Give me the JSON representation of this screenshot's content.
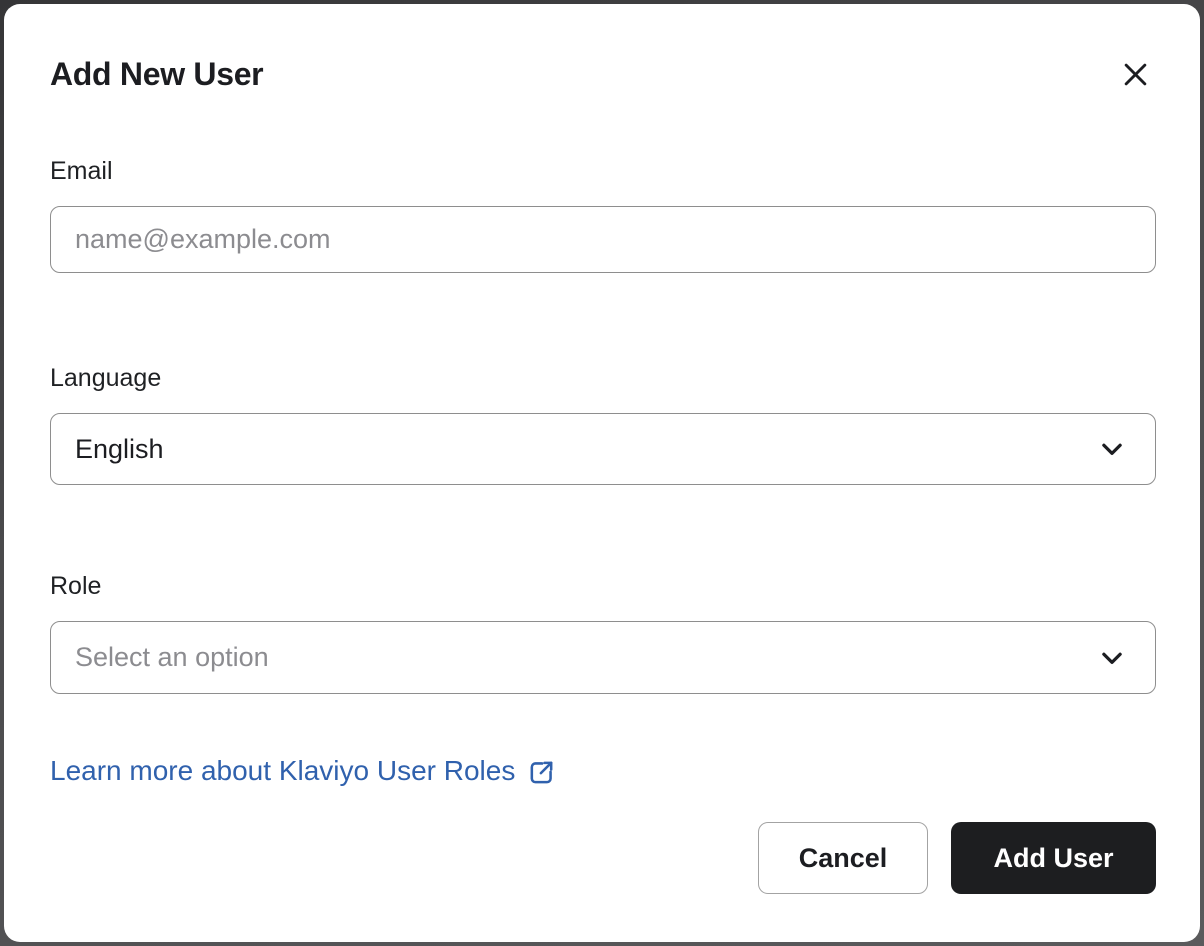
{
  "modal": {
    "title": "Add New User"
  },
  "form": {
    "email": {
      "label": "Email",
      "placeholder": "name@example.com",
      "value": ""
    },
    "language": {
      "label": "Language",
      "value": "English"
    },
    "role": {
      "label": "Role",
      "placeholder": "Select an option",
      "value": ""
    }
  },
  "link": {
    "text": "Learn more about Klaviyo User Roles"
  },
  "footer": {
    "cancel_label": "Cancel",
    "add_user_label": "Add User"
  },
  "colors": {
    "backdrop": "#4c4c4e",
    "modal_bg": "#ffffff",
    "text_dark": "#1c1d21",
    "placeholder_gray": "#8c8c90",
    "border_gray": "#8e8e8e",
    "link_blue": "#3061ad",
    "primary_button_bg": "#1d1e20",
    "primary_button_text": "#ffffff"
  }
}
